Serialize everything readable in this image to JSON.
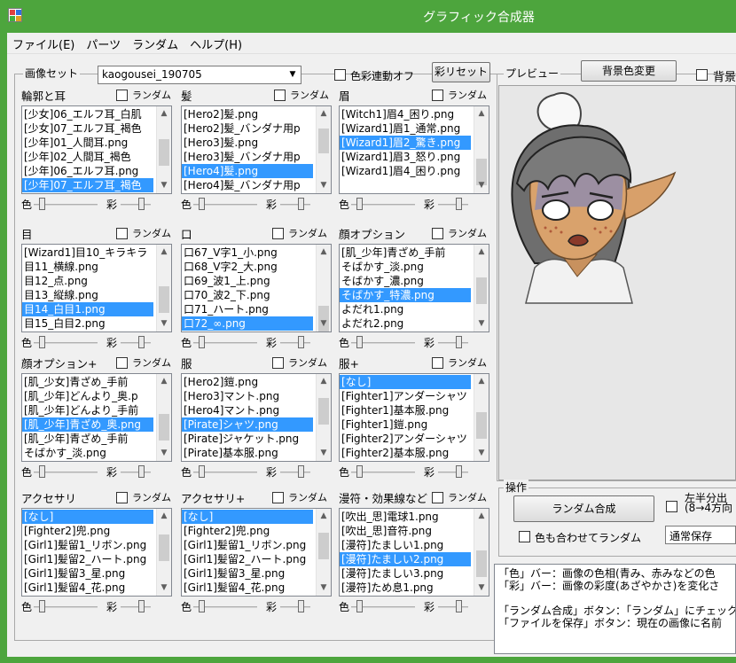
{
  "window": {
    "title": "グラフィック合成器"
  },
  "menu": [
    "ファイル(E)",
    "パーツ",
    "ランダム",
    "ヘルプ(H)"
  ],
  "image_set": {
    "legend": "画像セット",
    "selected": "kaogousei_190705",
    "sync_label": "色彩連動オフ",
    "reset_button": "彩リセット"
  },
  "preview": {
    "legend": "プレビュー",
    "bg_button": "背景色変更",
    "bg_check_label": "背景"
  },
  "common": {
    "random": "ランダム",
    "color": "色",
    "saturation": "彩"
  },
  "parts": [
    {
      "name": "輪郭と耳",
      "items": [
        "[少女]06_エルフ耳_白肌",
        "[少女]07_エルフ耳_褐色",
        "[少年]01_人間耳.png",
        "[少年]02_人間耳_褐色",
        "[少年]06_エルフ耳.png",
        "[少年]07_エルフ耳_褐色"
      ],
      "selected": 5
    },
    {
      "name": "髪",
      "items": [
        "[Hero2]髪.png",
        "[Hero2]髪_バンダナ用p",
        "[Hero3]髪.png",
        "[Hero3]髪_バンダナ用p",
        "[Hero4]髪.png",
        "[Hero4]髪_バンダナ用p"
      ],
      "selected": 4
    },
    {
      "name": "眉",
      "items": [
        "[Witch1]眉4_困り.png",
        "[Wizard1]眉1_通常.png",
        "[Wizard1]眉2_驚き.png",
        "[Wizard1]眉3_怒り.png",
        "[Wizard1]眉4_困り.png"
      ],
      "selected": 2
    },
    {
      "name": "目",
      "items": [
        "[Wizard1]目10_キラキラ",
        "目11_横線.png",
        "目12_点.png",
        "目13_縦線.png",
        "目14_白目1.png",
        "目15_白目2.png"
      ],
      "selected": 4
    },
    {
      "name": "口",
      "items": [
        "口67_V字1_小.png",
        "口68_V字2_大.png",
        "口69_波1_上.png",
        "口70_波2_下.png",
        "口71_ハート.png",
        "口72_∞.png"
      ],
      "selected": 5
    },
    {
      "name": "顔オプション",
      "items": [
        "[肌_少年]青ざめ_手前",
        "そばかす_淡.png",
        "そばかす_濃.png",
        "そばかす_特濃.png",
        "よだれ1.png",
        "よだれ2.png"
      ],
      "selected": 3
    },
    {
      "name": "顔オプション+",
      "items": [
        "[肌_少女]青ざめ_手前",
        "[肌_少年]どんより_奥.p",
        "[肌_少年]どんより_手前",
        "[肌_少年]青ざめ_奥.png",
        "[肌_少年]青ざめ_手前",
        "そばかす_淡.png"
      ],
      "selected": 3
    },
    {
      "name": "服",
      "items": [
        "[Hero2]鎧.png",
        "[Hero3]マント.png",
        "[Hero4]マント.png",
        "[Pirate]シャツ.png",
        "[Pirate]ジャケット.png",
        "[Pirate]基本服.png"
      ],
      "selected": 3
    },
    {
      "name": "服+",
      "items": [
        "[なし]",
        "[Fighter1]アンダーシャツ",
        "[Fighter1]基本服.png",
        "[Fighter1]鎧.png",
        "[Fighter2]アンダーシャツ",
        "[Fighter2]基本服.png"
      ],
      "selected": 0
    },
    {
      "name": "アクセサリ",
      "items": [
        "[なし]",
        "[Fighter2]兜.png",
        "[Girl1]髪留1_リボン.png",
        "[Girl1]髪留2_ハート.png",
        "[Girl1]髪留3_星.png",
        "[Girl1]髪留4_花.png"
      ],
      "selected": 0
    },
    {
      "name": "アクセサリ+",
      "items": [
        "[なし]",
        "[Fighter2]兜.png",
        "[Girl1]髪留1_リボン.png",
        "[Girl1]髪留2_ハート.png",
        "[Girl1]髪留3_星.png",
        "[Girl1]髪留4_花.png"
      ],
      "selected": 0
    },
    {
      "name": "漫符・効果線など",
      "items": [
        "[吹出_思]電球1.png",
        "[吹出_思]音符.png",
        "[漫符]たましい1.png",
        "[漫符]たましい2.png",
        "[漫符]たましい3.png",
        "[漫符]ため息1.png"
      ],
      "selected": 3
    }
  ],
  "operations": {
    "legend": "操作",
    "random_button": "ランダム合成",
    "color_random_label": "色も合わせてランダム",
    "half_label_1": "左半分出",
    "half_label_2": "(8→4方向",
    "save_mode": "通常保存"
  },
  "help_lines": [
    "「色」バー：画像の色相(青み、赤みなどの色",
    "「彩」バー：画像の彩度(あざやかさ)を変化さ",
    "",
    "「ランダム合成」ボタン：「ランダム」にチェックが",
    "「ファイルを保存」ボタン：現在の画像に名前"
  ],
  "colors": {
    "titlebar": "#4da53d",
    "selection": "#3399ff",
    "window": "#f0f0f0"
  }
}
